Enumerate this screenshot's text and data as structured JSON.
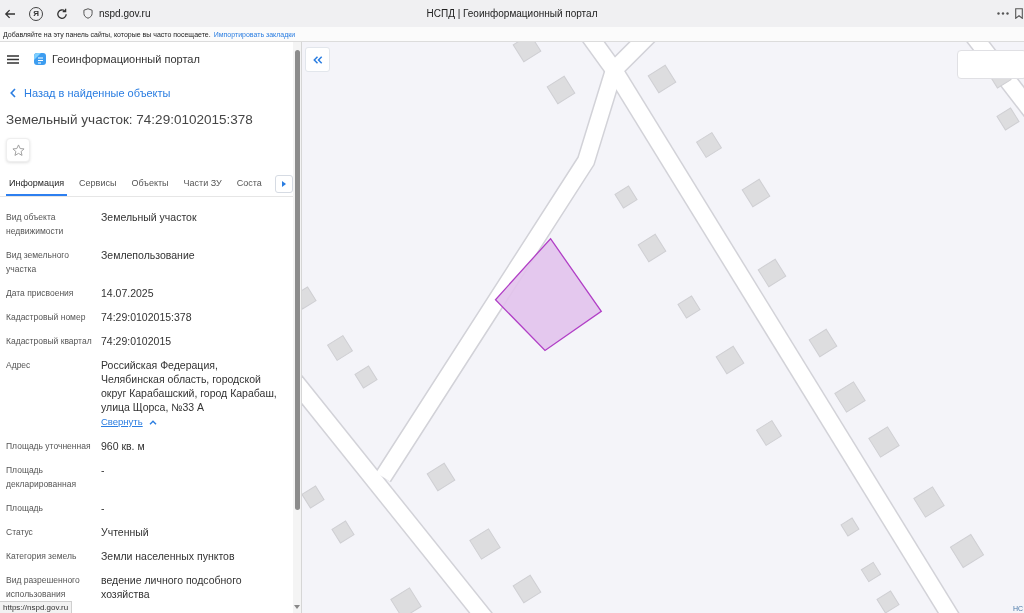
{
  "browser": {
    "logo": "Я",
    "url": "nspd.gov.ru",
    "title": "НСПД | Геоинформационный портал",
    "bookmarks_hint": "Добавляйте на эту панель сайты, которые вы часто посещаете.",
    "bookmarks_link": "Импортировать закладки"
  },
  "panel": {
    "app_name": "Геоинформационный портал",
    "back_link": "Назад в найденные объекты",
    "title": "Земельный участок: 74:29:0102015:378",
    "tabs": [
      {
        "label": "Информация",
        "selected": true
      },
      {
        "label": "Сервисы",
        "selected": false
      },
      {
        "label": "Объекты",
        "selected": false
      },
      {
        "label": "Части ЗУ",
        "selected": false
      },
      {
        "label": "Соста",
        "selected": false
      }
    ],
    "fields": [
      {
        "label": "Вид объекта недвижимости",
        "value": "Земельный участок"
      },
      {
        "label": "Вид земельного участка",
        "value": "Землепользование"
      },
      {
        "label": "Дата присвоения",
        "value": "14.07.2025"
      },
      {
        "label": "Кадастровый номер",
        "value": "74:29:0102015:378"
      },
      {
        "label": "Кадастровый квартал",
        "value": "74:29:0102015"
      },
      {
        "label": "Адрес",
        "value": "Российская Федерация, Челябинская область, городской округ Карабашский, город Карабаш, улица Щорса, №33 А",
        "toggle": "Свернуть"
      },
      {
        "label": "Площадь уточненная",
        "value": "960 кв. м"
      },
      {
        "label": "Площадь декларированная",
        "value": "-"
      },
      {
        "label": "Площадь",
        "value": "-"
      },
      {
        "label": "Статус",
        "value": "Учтенный"
      },
      {
        "label": "Категория земель",
        "value": "Земли населенных пунктов"
      },
      {
        "label": "Вид разрешенного использования",
        "value": "ведение личного подсобного хозяйства"
      }
    ]
  },
  "map": {
    "attribution": "НС"
  },
  "status_url": "https://nspd.gov.ru"
}
